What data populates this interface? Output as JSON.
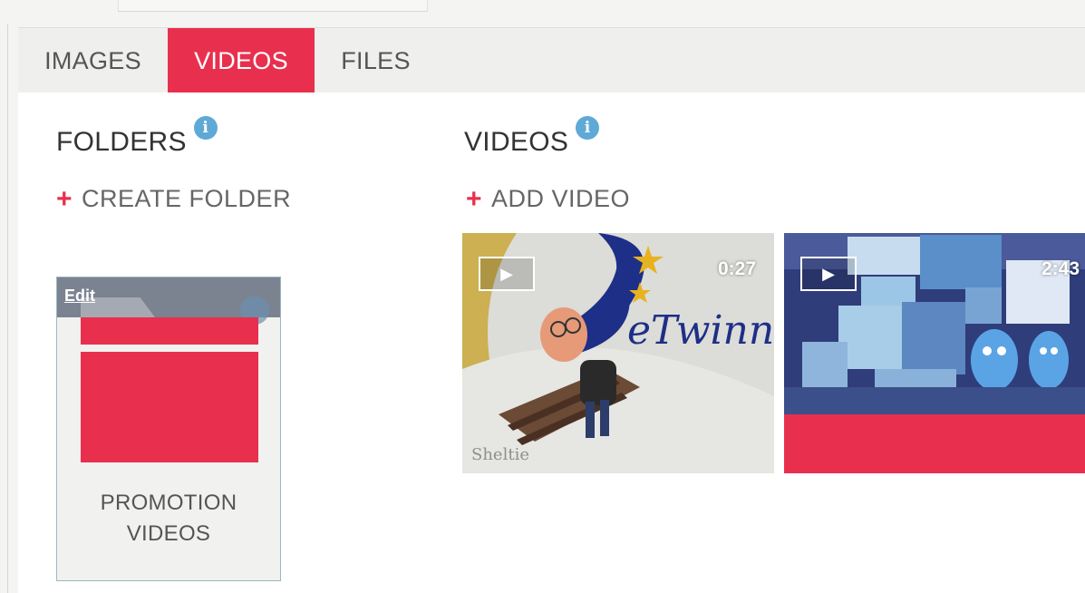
{
  "tabs": [
    {
      "label": "IMAGES"
    },
    {
      "label": "VIDEOS"
    },
    {
      "label": "FILES"
    }
  ],
  "active_tab": "VIDEOS",
  "folders": {
    "title": "FOLDERS",
    "create_label": "CREATE FOLDER",
    "items": [
      {
        "edit_label": "Edit",
        "name_line1": "PROMOTION",
        "name_line2": "VIDEOS"
      }
    ]
  },
  "videos": {
    "title": "VIDEOS",
    "add_label": "ADD VIDEO",
    "items": [
      {
        "duration": "0:27",
        "thumbnail_text": "eTwinn"
      },
      {
        "duration": "2:43"
      }
    ]
  },
  "icons": {
    "info": "info-icon",
    "plus": "plus-icon",
    "play": "play-icon"
  },
  "colors": {
    "accent": "#e8304e",
    "info": "#5fa9d6",
    "tab_bar": "#efefed"
  }
}
